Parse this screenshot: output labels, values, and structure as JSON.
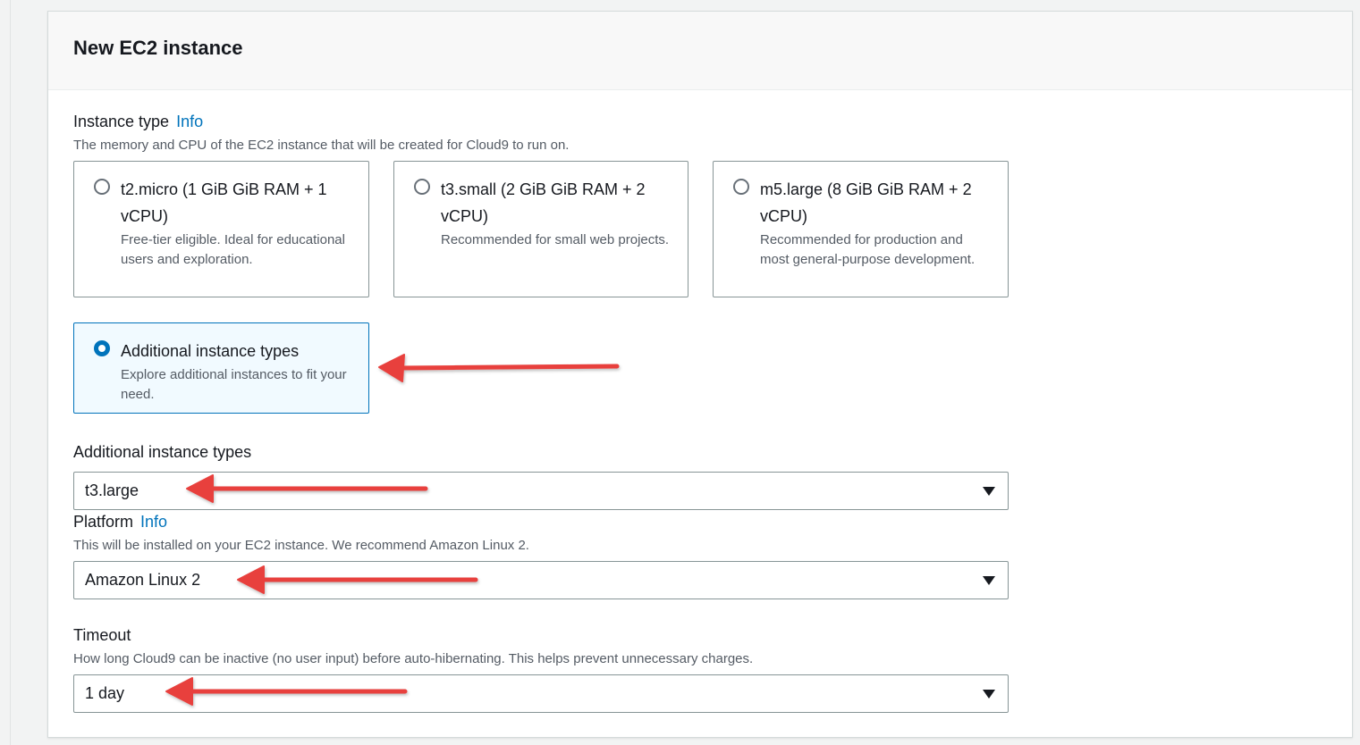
{
  "panel": {
    "title": "New EC2 instance"
  },
  "instance_type": {
    "label": "Instance type",
    "info": "Info",
    "description": "The memory and CPU of the EC2 instance that will be created for Cloud9 to run on.",
    "options": [
      {
        "title": "t2.micro (1 GiB GiB RAM + 1 vCPU)",
        "description": "Free-tier eligible. Ideal for educational users and exploration.",
        "selected": false
      },
      {
        "title": "t3.small (2 GiB GiB RAM + 2 vCPU)",
        "description": "Recommended for small web projects.",
        "selected": false
      },
      {
        "title": "m5.large (8 GiB GiB RAM + 2 vCPU)",
        "description": "Recommended for production and most general-purpose development.",
        "selected": false
      },
      {
        "title": "Additional instance types",
        "description": "Explore additional instances to fit your need.",
        "selected": true
      }
    ]
  },
  "additional_types": {
    "label": "Additional instance types",
    "value": "t3.large"
  },
  "platform": {
    "label": "Platform",
    "info": "Info",
    "description": "This will be installed on your EC2 instance. We recommend Amazon Linux 2.",
    "value": "Amazon Linux 2"
  },
  "timeout": {
    "label": "Timeout",
    "description": "How long Cloud9 can be inactive (no user input) before auto-hibernating. This helps prevent unnecessary charges.",
    "value": "1 day"
  },
  "colors": {
    "accent": "#0073bb",
    "annotation_arrow": "#e8413d"
  },
  "icons": [
    "radio-icon",
    "caret-down-icon",
    "annotation-arrow-icon"
  ]
}
